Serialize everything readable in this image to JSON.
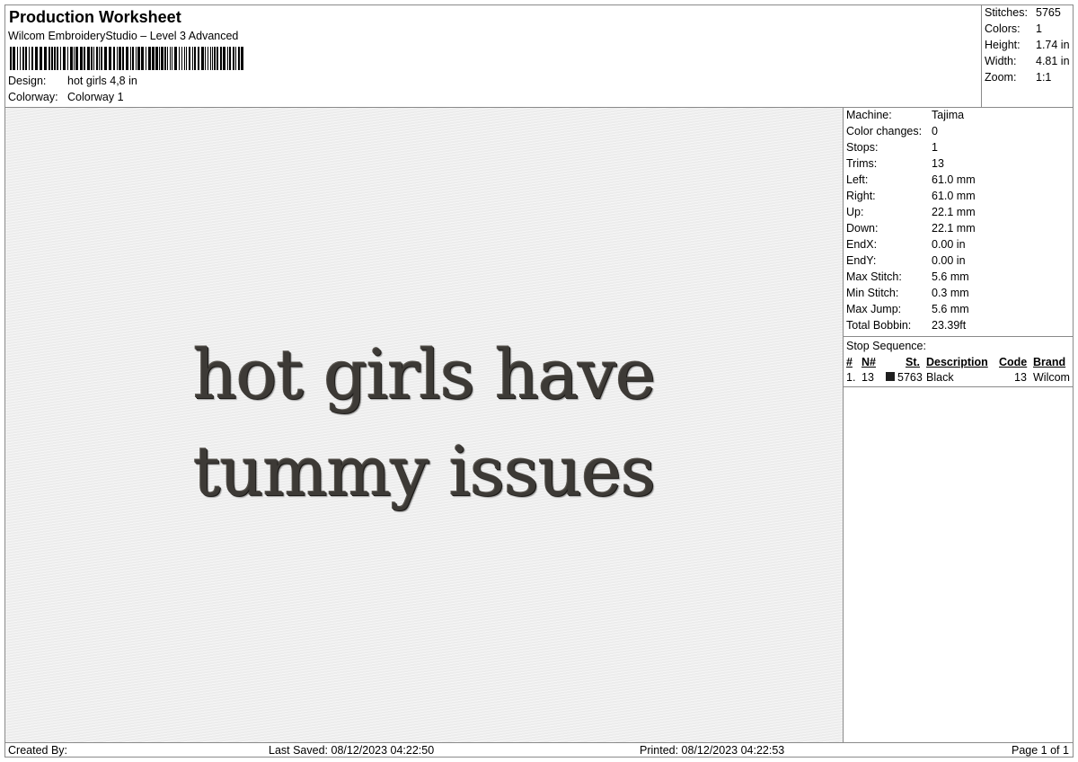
{
  "header": {
    "title": "Production Worksheet",
    "subtitle": "Wilcom EmbroideryStudio – Level 3 Advanced",
    "design_label": "Design:",
    "design_value": "hot girls 4,8 in",
    "colorway_label": "Colorway:",
    "colorway_value": "Colorway 1"
  },
  "summary": {
    "stitches_label": "Stitches:",
    "stitches_value": "5765",
    "colors_label": "Colors:",
    "colors_value": "1",
    "height_label": "Height:",
    "height_value": "1.74 in",
    "width_label": "Width:",
    "width_value": "4.81 in",
    "zoom_label": "Zoom:",
    "zoom_value": "1:1"
  },
  "design": {
    "line1": "hot girls have",
    "line2": "tummy issues",
    "thread_color": "#3d3a36"
  },
  "machine_info": [
    {
      "label": "Machine:",
      "value": "Tajima"
    },
    {
      "label": "Color changes:",
      "value": "0"
    },
    {
      "label": "Stops:",
      "value": "1"
    },
    {
      "label": "Trims:",
      "value": "13"
    },
    {
      "label": "Left:",
      "value": "61.0 mm"
    },
    {
      "label": "Right:",
      "value": "61.0 mm"
    },
    {
      "label": "Up:",
      "value": "22.1 mm"
    },
    {
      "label": "Down:",
      "value": "22.1 mm"
    },
    {
      "label": "EndX:",
      "value": "0.00 in"
    },
    {
      "label": "EndY:",
      "value": "0.00 in"
    },
    {
      "label": "Max Stitch:",
      "value": "5.6 mm"
    },
    {
      "label": "Min Stitch:",
      "value": "0.3 mm"
    },
    {
      "label": "Max Jump:",
      "value": "5.6 mm"
    },
    {
      "label": "Total Bobbin:",
      "value": "23.39ft"
    }
  ],
  "stop_sequence": {
    "title": "Stop Sequence:",
    "headers": {
      "num": "#",
      "n": "N#",
      "st": "St.",
      "description": "Description",
      "code": "Code",
      "brand": "Brand"
    },
    "rows": [
      {
        "num": "1.",
        "n": "13",
        "swatch_color": "#1f1f1f",
        "st": "5763",
        "description": "Black",
        "code": "13",
        "brand": "Wilcom"
      }
    ]
  },
  "footer": {
    "created_by": "Created By:",
    "last_saved": "Last Saved: 08/12/2023 04:22:50",
    "printed": "Printed: 08/12/2023 04:22:53",
    "page": "Page 1 of 1"
  }
}
